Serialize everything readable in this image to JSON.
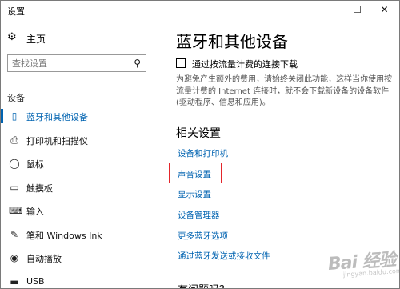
{
  "window": {
    "title": "设置",
    "minimize_icon": "—",
    "maximize_icon": "☐",
    "close_icon": "✕"
  },
  "sidebar": {
    "home_label": "主页",
    "search_placeholder": "查找设置",
    "section_label": "设备",
    "items": [
      {
        "label": "蓝牙和其他设备",
        "icon": "bluetooth-devices-icon",
        "active": true
      },
      {
        "label": "打印机和扫描仪",
        "icon": "printer-icon",
        "active": false
      },
      {
        "label": "鼠标",
        "icon": "mouse-icon",
        "active": false
      },
      {
        "label": "触摸板",
        "icon": "touchpad-icon",
        "active": false
      },
      {
        "label": "输入",
        "icon": "keyboard-icon",
        "active": false
      },
      {
        "label": "笔和 Windows Ink",
        "icon": "pen-icon",
        "active": false
      },
      {
        "label": "自动播放",
        "icon": "autoplay-icon",
        "active": false
      },
      {
        "label": "USB",
        "icon": "usb-icon",
        "active": false
      }
    ]
  },
  "main": {
    "title": "蓝牙和其他设备",
    "metered_checkbox_label": "通过按流量计费的连接下载",
    "metered_checkbox_checked": false,
    "metered_description": "为避免产生额外的费用，请始终关闭此功能，这样当你使用按流量计费的 Internet 连接时，就不会下载新设备的设备软件(驱动程序、信息和应用)。",
    "related_title": "相关设置",
    "links": {
      "devices_printers": "设备和打印机",
      "sound": "声音设置",
      "display": "显示设置",
      "device_manager": "设备管理器",
      "more_bluetooth": "更多蓝牙选项",
      "bluetooth_send_receive": "通过蓝牙发送或接收文件"
    },
    "partial_heading": "有问题吗？"
  },
  "watermark": {
    "text": "Bai 经验",
    "sub": "jingyan.baidu.com"
  },
  "colors": {
    "accent": "#0063b1",
    "highlight": "#e4262b"
  }
}
